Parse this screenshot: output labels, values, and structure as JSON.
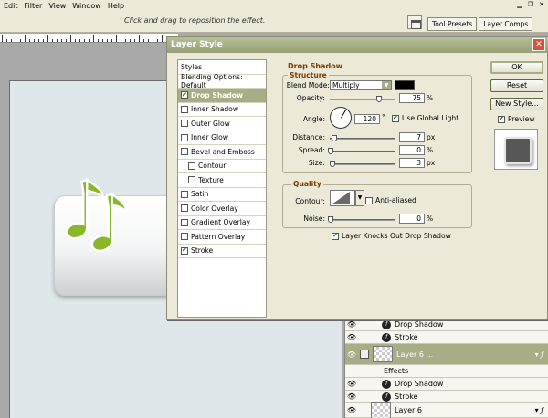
{
  "menu": [
    {
      "label": "Edit",
      "accel": "E"
    },
    {
      "label": "Filter",
      "accel": "F"
    },
    {
      "label": "View",
      "accel": "V"
    },
    {
      "label": "Window",
      "accel": "W"
    },
    {
      "label": "Help",
      "accel": "H"
    }
  ],
  "options_bar": {
    "hint": "Click and drag to reposition the effect.",
    "palette_tabs": [
      "Tool Presets",
      "Layer Comps"
    ]
  },
  "dialog": {
    "title": "Layer Style",
    "styles_header": "Styles",
    "blending_options": "Blending Options: Default",
    "style_items": [
      {
        "label": "Drop Shadow",
        "checked": true,
        "selected": true
      },
      {
        "label": "Inner Shadow",
        "checked": false
      },
      {
        "label": "Outer Glow",
        "checked": false
      },
      {
        "label": "Inner Glow",
        "checked": false
      },
      {
        "label": "Bevel and Emboss",
        "checked": false
      },
      {
        "label": "Contour",
        "checked": false,
        "sub": true
      },
      {
        "label": "Texture",
        "checked": false,
        "sub": true
      },
      {
        "label": "Satin",
        "checked": false
      },
      {
        "label": "Color Overlay",
        "checked": false
      },
      {
        "label": "Gradient Overlay",
        "checked": false
      },
      {
        "label": "Pattern Overlay",
        "checked": false
      },
      {
        "label": "Stroke",
        "checked": true
      }
    ],
    "group_title": "Drop Shadow",
    "structure": {
      "legend": "Structure",
      "blend_mode_label": "Blend Mode:",
      "blend_mode_value": "Multiply",
      "shadow_color": "#000000",
      "opacity_label": "Opacity:",
      "opacity_value": "75",
      "opacity_fraction": 0.75,
      "percent": "%",
      "angle_label": "Angle:",
      "angle_value": "120",
      "degree": "°",
      "use_global_light": "Use Global Light",
      "use_global_light_checked": true,
      "distance_label": "Distance:",
      "distance_value": "7",
      "spread_label": "Spread:",
      "spread_value": "0",
      "size_label": "Size:",
      "size_value": "3",
      "px": "px"
    },
    "quality": {
      "legend": "Quality",
      "contour_label": "Contour:",
      "anti_aliased": "Anti-aliased",
      "anti_aliased_checked": false,
      "noise_label": "Noise:",
      "noise_value": "0"
    },
    "knocks_out": "Layer Knocks Out Drop Shadow",
    "knocks_out_checked": true,
    "buttons": {
      "ok": "OK",
      "reset": "Reset",
      "new_style": "New Style...",
      "preview": "Preview",
      "preview_checked": true
    }
  },
  "layers": [
    {
      "type": "effect",
      "label": "Drop Shadow"
    },
    {
      "type": "effect",
      "label": "Stroke"
    },
    {
      "type": "layer",
      "label": "Layer 6 ...",
      "selected": true
    },
    {
      "type": "effects-header",
      "label": "Effects"
    },
    {
      "type": "effect",
      "label": "Drop Shadow"
    },
    {
      "type": "effect",
      "label": "Stroke"
    },
    {
      "type": "layer",
      "label": "Layer 6"
    }
  ],
  "colors": {
    "accent": "#a7ad84",
    "title_bar": "#98a074",
    "note_green": "#8ab62a",
    "close_red": "#d8513a"
  }
}
